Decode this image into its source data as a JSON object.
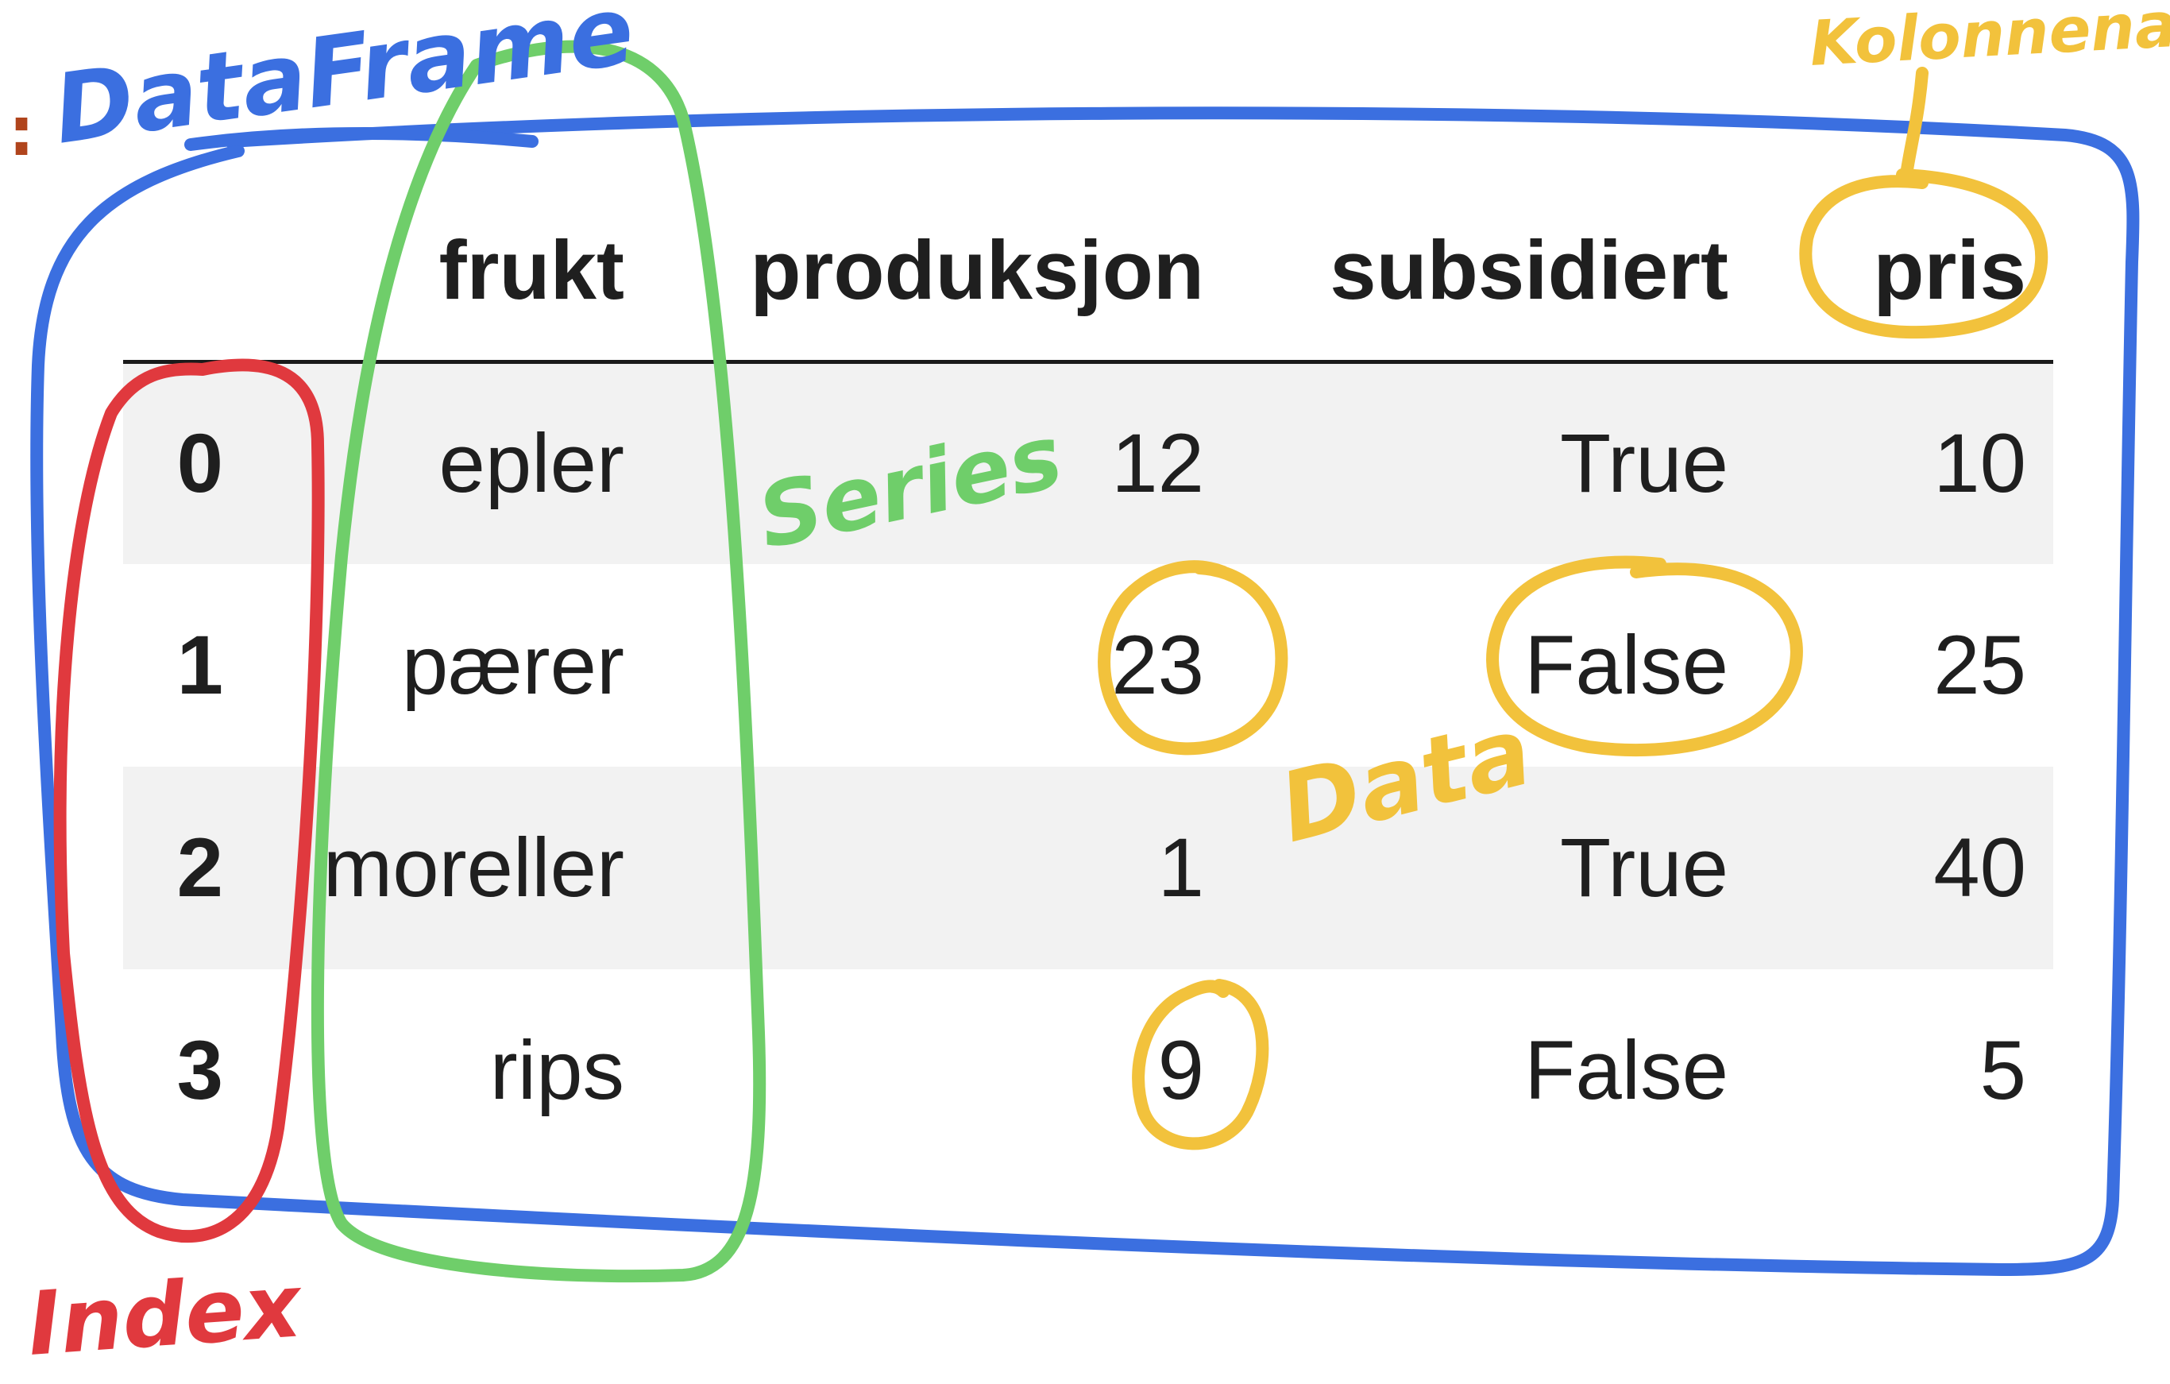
{
  "prompt_mark": ":",
  "table": {
    "columns": [
      "frukt",
      "produksjon",
      "subsidiert",
      "pris"
    ],
    "rows": [
      {
        "index": "0",
        "cells": [
          "epler",
          "12",
          "True",
          "10"
        ]
      },
      {
        "index": "1",
        "cells": [
          "pærer",
          "23",
          "False",
          "25"
        ]
      },
      {
        "index": "2",
        "cells": [
          "moreller",
          "1",
          "True",
          "40"
        ]
      },
      {
        "index": "3",
        "cells": [
          "rips",
          "9",
          "False",
          "5"
        ]
      }
    ]
  },
  "annotations": {
    "dataframe": "DataFrame",
    "series": "Series",
    "index": "Index",
    "data": "Data",
    "column_name": "Kolonnenavn"
  },
  "colors": {
    "dataframe": "#3b6fe0",
    "series": "#6fce6a",
    "index": "#e0393e",
    "highlight": "#f2c23c"
  }
}
